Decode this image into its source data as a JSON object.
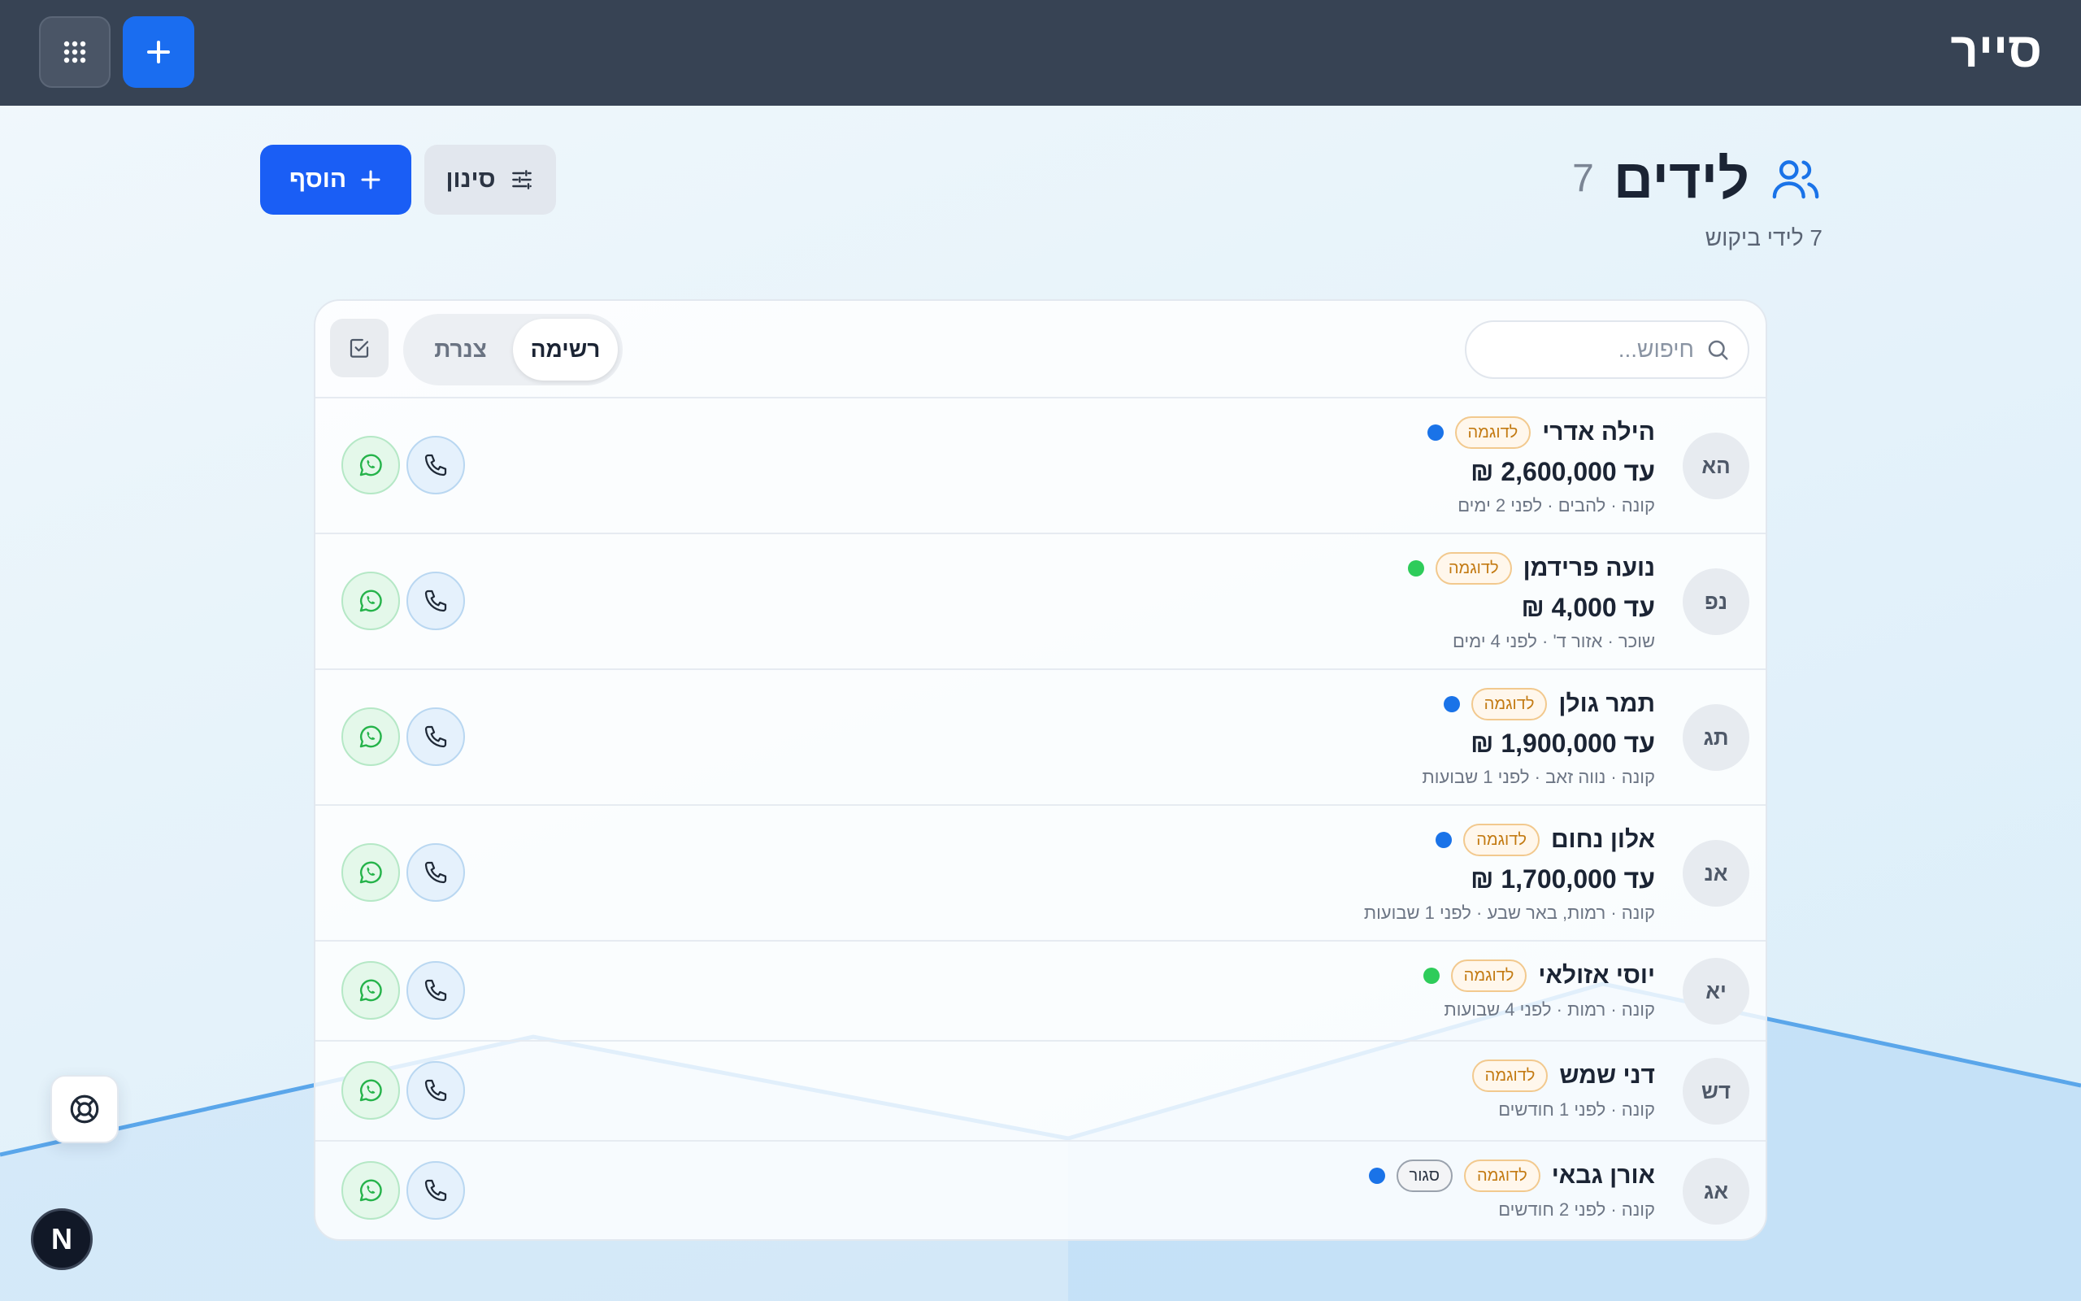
{
  "app": {
    "brand": "סייר"
  },
  "header": {
    "title": "לידים",
    "count": "7",
    "subtitle": "7 לידי ביקוש",
    "add_label": "הוסף",
    "filter_label": "סינון"
  },
  "toolbar": {
    "search_placeholder": "חיפוש...",
    "view_list": "רשימה",
    "view_kanban": "צנרת"
  },
  "leads": [
    {
      "initials": "הא",
      "name": "הילה אדרי",
      "badge": "לדוגמה",
      "status_color": "#1a73e8",
      "price": "עד 2,600,000 ₪",
      "meta": "קונה · להבים · לפני 2 ימים"
    },
    {
      "initials": "נפ",
      "name": "נועה פרידמן",
      "badge": "לדוגמה",
      "status_color": "#2ecc5a",
      "price": "עד 4,000 ₪",
      "meta": "שוכר · אזור ד' · לפני 4 ימים"
    },
    {
      "initials": "תג",
      "name": "תמר גולן",
      "badge": "לדוגמה",
      "status_color": "#1a73e8",
      "price": "עד 1,900,000 ₪",
      "meta": "קונה · נווה זאב · לפני 1 שבועות"
    },
    {
      "initials": "אנ",
      "name": "אלון נחום",
      "badge": "לדוגמה",
      "status_color": "#1a73e8",
      "price": "עד 1,700,000 ₪",
      "meta": "קונה · רמות, באר שבע · לפני 1 שבועות"
    },
    {
      "initials": "יא",
      "name": "יוסי אזולאי",
      "badge": "לדוגמה",
      "status_color": "#2ecc5a",
      "meta": "קונה · רמות · לפני 4 שבועות"
    },
    {
      "initials": "דש",
      "name": "דני שמש",
      "badge": "לדוגמה",
      "meta": "קונה · לפני 1 חודשים"
    },
    {
      "initials": "אג",
      "name": "אורן גבאי",
      "badge": "לדוגמה",
      "closed_badge": "סגור",
      "status_color": "#1a73e8",
      "meta": "קונה · לפני 2 חודשים"
    }
  ],
  "floating": {
    "n_badge": "N"
  }
}
